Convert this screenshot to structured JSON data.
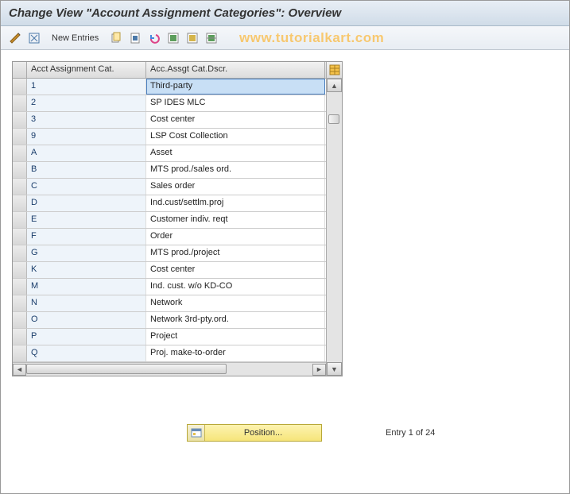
{
  "title": "Change View \"Account Assignment Categories\": Overview",
  "toolbar": {
    "new_entries": "New Entries"
  },
  "watermark": "www.tutorialkart.com",
  "table": {
    "headers": {
      "col1": "Acct Assignment Cat.",
      "col2": "Acc.Assgt Cat.Dscr."
    },
    "rows": [
      {
        "cat": "1",
        "desc": "Third-party"
      },
      {
        "cat": "2",
        "desc": "SP IDES MLC"
      },
      {
        "cat": "3",
        "desc": "Cost center"
      },
      {
        "cat": "9",
        "desc": "LSP Cost Collection"
      },
      {
        "cat": "A",
        "desc": "Asset"
      },
      {
        "cat": "B",
        "desc": "MTS prod./sales ord."
      },
      {
        "cat": "C",
        "desc": "Sales order"
      },
      {
        "cat": "D",
        "desc": "Ind.cust/settlm.proj"
      },
      {
        "cat": "E",
        "desc": "Customer indiv. reqt"
      },
      {
        "cat": "F",
        "desc": "Order"
      },
      {
        "cat": "G",
        "desc": "MTS prod./project"
      },
      {
        "cat": "K",
        "desc": "Cost center"
      },
      {
        "cat": "M",
        "desc": "Ind. cust. w/o KD-CO"
      },
      {
        "cat": "N",
        "desc": "Network"
      },
      {
        "cat": "O",
        "desc": "Network 3rd-pty.ord."
      },
      {
        "cat": "P",
        "desc": "Project"
      },
      {
        "cat": "Q",
        "desc": "Proj. make-to-order"
      }
    ]
  },
  "footer": {
    "position_label": "Position...",
    "entry_text": "Entry 1 of 24"
  }
}
